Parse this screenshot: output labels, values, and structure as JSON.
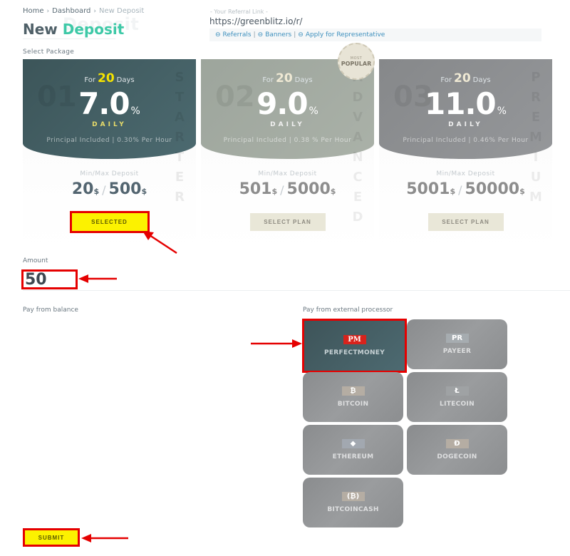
{
  "breadcrumb": [
    "Home",
    "Dashboard",
    "New Deposit"
  ],
  "page_title": {
    "part1": "New",
    "part2": "Deposit",
    "ghost": "Deposit"
  },
  "referral": {
    "label": "- Your Referral Link -",
    "link": "https://greenblitz.io/r/",
    "links": [
      "Referrals",
      "Banners",
      "Apply for Representative"
    ]
  },
  "select_package_label": "Select Package",
  "badge": {
    "line1": "MOST",
    "line2": "POPULAR"
  },
  "plans": [
    {
      "num": "01",
      "for": "For",
      "days": "20",
      "days_label": "Days",
      "rate": "7.0",
      "pct": "%",
      "period": "DAILY",
      "principal": "Principal Included | 0.30% Per Hour",
      "minmax_label": "Min/Max Deposit",
      "min": "20",
      "max": "500",
      "currency": "$",
      "button": "SELECTED",
      "side": [
        "S",
        "T",
        "A",
        "R",
        "T",
        "E",
        "R"
      ]
    },
    {
      "num": "02",
      "for": "For",
      "days": "20",
      "days_label": "Days",
      "rate": "9.0",
      "pct": "%",
      "period": "DAILY",
      "principal": "Principal Included | 0.38 % Per Hour",
      "minmax_label": "Min/Max Deposit",
      "min": "501",
      "max": "5000",
      "currency": "$",
      "button": "SELECT PLAN",
      "side": [
        "A",
        "D",
        "V",
        "A",
        "N",
        "C",
        "E",
        "D"
      ]
    },
    {
      "num": "03",
      "for": "For",
      "days": "20",
      "days_label": "Days",
      "rate": "11.0",
      "pct": "%",
      "period": "DAILY",
      "principal": "Principal Included | 0.46% Per Hour",
      "minmax_label": "Min/Max Deposit",
      "min": "5001",
      "max": "50000",
      "currency": "$",
      "button": "SELECT PLAN",
      "side": [
        "P",
        "R",
        "E",
        "M",
        "I",
        "U",
        "M"
      ]
    }
  ],
  "amount": {
    "label": "Amount",
    "value": "50"
  },
  "pay_balance_label": "Pay from balance",
  "pay_external_label": "Pay from external processor",
  "processors": [
    {
      "logo": "PM",
      "name": "PERFECTMONEY",
      "selected": true
    },
    {
      "logo": "PR",
      "name": "PAYEER",
      "selected": false
    },
    {
      "logo": "₿",
      "name": "BITCOIN",
      "selected": false
    },
    {
      "logo": "Ł",
      "name": "LITECOIN",
      "selected": false
    },
    {
      "logo": "◆",
      "name": "ETHEREUM",
      "selected": false
    },
    {
      "logo": "Ð",
      "name": "DOGECOIN",
      "selected": false
    },
    {
      "logo": "(₿)",
      "name": "BITCOINCASH",
      "selected": false
    }
  ],
  "submit_label": "SUBMIT"
}
